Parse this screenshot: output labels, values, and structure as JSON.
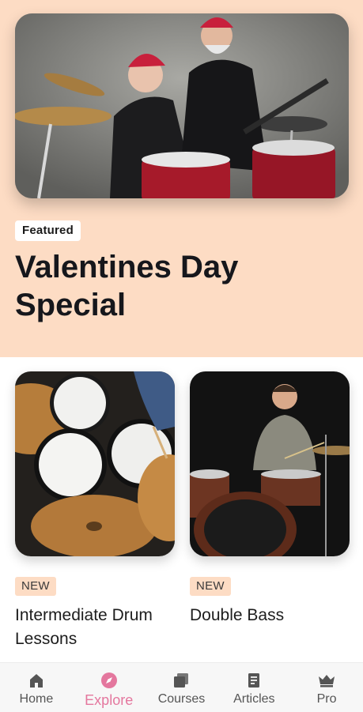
{
  "featured": {
    "badge": "Featured",
    "title": "Valentines Day Special"
  },
  "cards": [
    {
      "badge": "NEW",
      "title": "Intermediate Drum Lessons"
    },
    {
      "badge": "NEW",
      "title": "Double Bass"
    }
  ],
  "nav": {
    "items": [
      {
        "label": "Home",
        "icon": "home-icon"
      },
      {
        "label": "Explore",
        "icon": "compass-icon",
        "active": true
      },
      {
        "label": "Courses",
        "icon": "stack-icon"
      },
      {
        "label": "Articles",
        "icon": "book-icon"
      },
      {
        "label": "Pro",
        "icon": "crown-icon"
      }
    ]
  },
  "colors": {
    "hero_background": "#fddcc4",
    "accent": "#e4779e",
    "badge_background": "#fddcc4"
  }
}
